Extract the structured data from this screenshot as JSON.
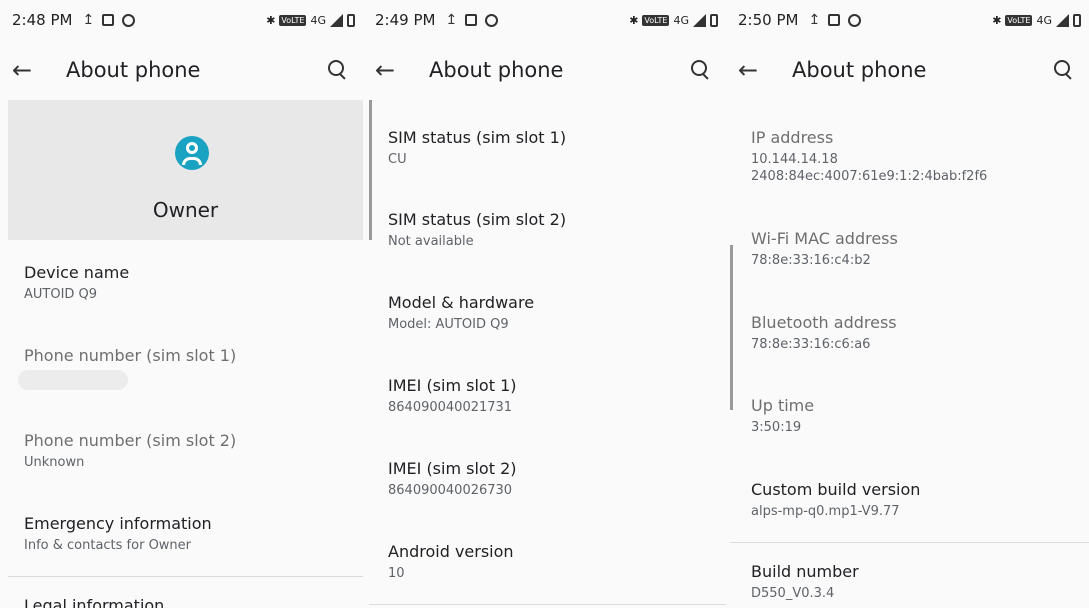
{
  "screens": [
    {
      "time": "2:48 PM",
      "title": "About phone",
      "owner": "Owner",
      "items": [
        {
          "label": "Device name",
          "value": "AUTOID Q9"
        },
        {
          "label": "Phone number (sim slot 1)",
          "value": ""
        },
        {
          "label": "Phone number (sim slot 2)",
          "value": "Unknown"
        },
        {
          "label": "Emergency information",
          "value": "Info & contacts for Owner"
        },
        {
          "label": "Legal information",
          "value": ""
        }
      ]
    },
    {
      "time": "2:49 PM",
      "title": "About phone",
      "items": [
        {
          "label": "SIM status (sim slot 1)",
          "value": "CU"
        },
        {
          "label": "SIM status (sim slot 2)",
          "value": "Not available"
        },
        {
          "label": "Model & hardware",
          "value": "Model: AUTOID Q9"
        },
        {
          "label": "IMEI (sim slot 1)",
          "value": "864090040021731"
        },
        {
          "label": "IMEI (sim slot 2)",
          "value": "864090040026730"
        },
        {
          "label": "Android version",
          "value": "10"
        }
      ]
    },
    {
      "time": "2:50 PM",
      "title": "About phone",
      "items": [
        {
          "label": "IP address",
          "value": "10.144.14.18\n2408:84ec:4007:61e9:1:2:4bab:f2f6"
        },
        {
          "label": "Wi-Fi MAC address",
          "value": "78:8e:33:16:c4:b2"
        },
        {
          "label": "Bluetooth address",
          "value": "78:8e:33:16:c6:a6"
        },
        {
          "label": "Up time",
          "value": "3:50:19"
        },
        {
          "label": "Custom build version",
          "value": "alps-mp-q0.mp1-V9.77"
        },
        {
          "label": "Build number",
          "value": "D550_V0.3.4"
        }
      ]
    }
  ],
  "status": {
    "network": "4G",
    "volte": "VoLTE",
    "upload_icon": "upload-icon",
    "bluetooth_icon": "bluetooth-icon"
  }
}
